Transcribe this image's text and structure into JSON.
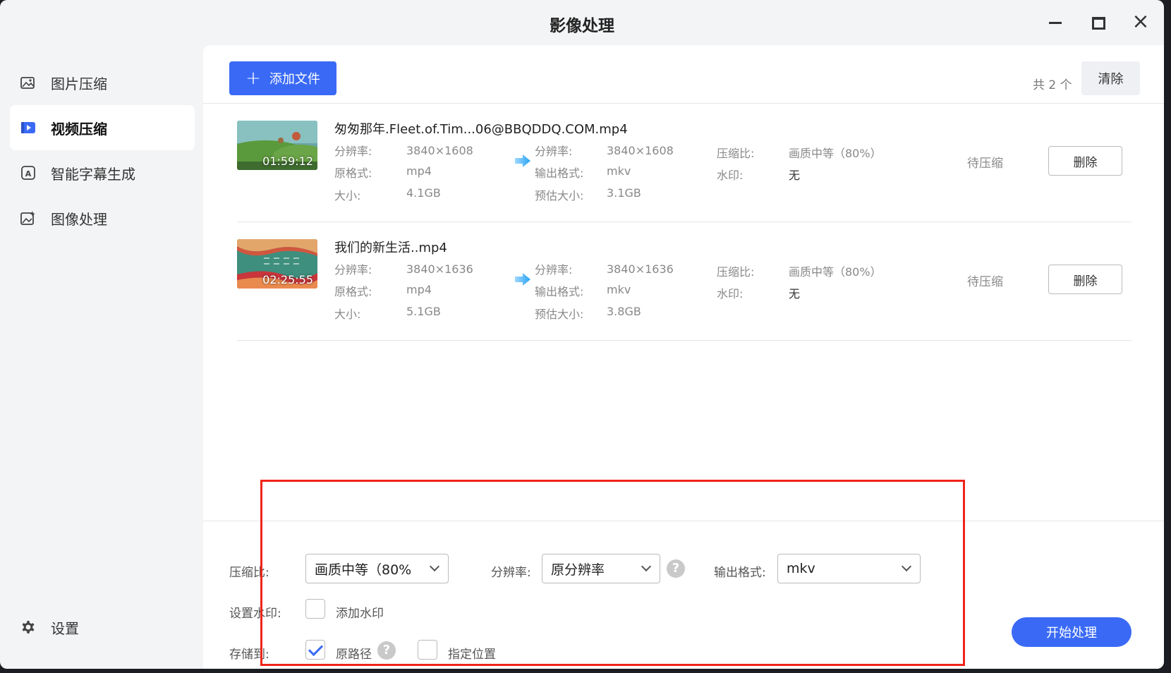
{
  "window": {
    "title": "影像处理"
  },
  "sidebar": {
    "items": [
      {
        "label": "图片压缩",
        "icon": "image-compress-icon"
      },
      {
        "label": "视频压缩",
        "icon": "video-compress-icon"
      },
      {
        "label": "智能字幕生成",
        "icon": "subtitle-icon"
      },
      {
        "label": "图像处理",
        "icon": "image-edit-icon"
      }
    ],
    "settings_label": "设置"
  },
  "toolbar": {
    "add_label": "添加文件",
    "count_text": "共 2 个",
    "clear_label": "清除"
  },
  "labels": {
    "resolution": "分辨率:",
    "src_format": "原格式:",
    "size": "大小:",
    "out_format": "输出格式:",
    "est_size": "预估大小:",
    "ratio": "压缩比:",
    "watermark": "水印:",
    "delete": "删除"
  },
  "files": [
    {
      "name": "匆匆那年.Fleet.of.Tim...06@BBQDDQ.COM.mp4",
      "duration": "01:59:12",
      "src_resolution": "3840×1608",
      "src_format": "mp4",
      "src_size": "4.1GB",
      "out_resolution": "3840×1608",
      "out_format": "mkv",
      "est_size": "3.1GB",
      "ratio": "画质中等（80%）",
      "watermark": "无",
      "status": "待压缩"
    },
    {
      "name": "我们的新生活..mp4",
      "duration": "02:25:55",
      "src_resolution": "3840×1636",
      "src_format": "mp4",
      "src_size": "5.1GB",
      "out_resolution": "3840×1636",
      "out_format": "mkv",
      "est_size": "3.8GB",
      "ratio": "画质中等（80%）",
      "watermark": "无",
      "status": "待压缩"
    }
  ],
  "settings_panel": {
    "ratio_label": "压缩比:",
    "ratio_value": "画质中等（80%",
    "resolution_label": "分辨率:",
    "resolution_value": "原分辨率",
    "format_label": "输出格式:",
    "format_value": "mkv",
    "watermark_label": "设置水印:",
    "watermark_option": "添加水印",
    "watermark_checked": false,
    "save_label": "存储到:",
    "save_original": "原路径",
    "save_original_checked": true,
    "save_custom": "指定位置",
    "save_custom_checked": false,
    "start_label": "开始处理"
  },
  "colors": {
    "accent": "#3a6af5",
    "highlight": "#f0241b"
  }
}
